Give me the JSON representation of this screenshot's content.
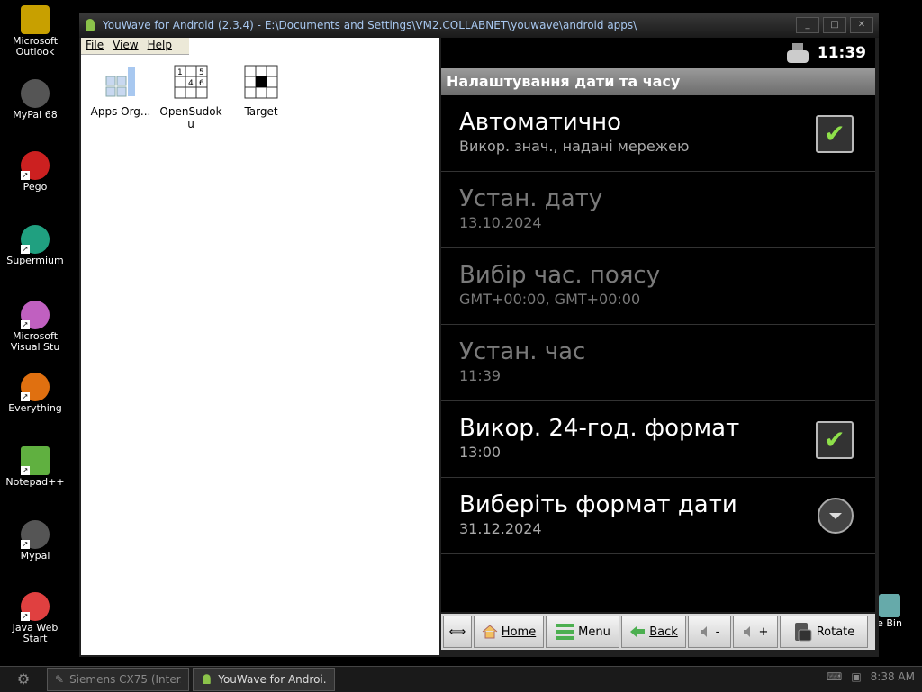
{
  "desktop": {
    "icons": [
      {
        "label": "Microsoft\nOutlook",
        "color": "#c8a000"
      },
      {
        "label": "MyPal 68",
        "color": "#555555"
      },
      {
        "label": "Pego",
        "color": "#cc2020"
      },
      {
        "label": "Supermium",
        "color": "#20a080"
      },
      {
        "label": "Microsoft\nVisual Stu",
        "color": "#c060c0"
      },
      {
        "label": "Everything",
        "color": "#e07010"
      },
      {
        "label": "Notepad++",
        "color": "#60b040"
      },
      {
        "label": "Mypal",
        "color": "#555555"
      },
      {
        "label": "Java Web\nStart",
        "color": "#e04040"
      }
    ],
    "recycle_label": "e Bin"
  },
  "window": {
    "title": "YouWave for Android (2.3.4) - E:\\Documents and Settings\\VM2.COLLABNET\\youwave\\android apps\\",
    "menu": [
      "File",
      "View",
      "Help"
    ],
    "apps": [
      {
        "label": "Apps Org..."
      },
      {
        "label": "OpenSudoku"
      },
      {
        "label": "Target"
      }
    ]
  },
  "android": {
    "clock": "11:39",
    "header": "Налаштування дати та часу",
    "items": [
      {
        "title": "Автоматично",
        "subtitle": "Викор. знач., надані мережею",
        "control": "check",
        "enabled": true
      },
      {
        "title": "Устан. дату",
        "subtitle": "13.10.2024",
        "control": "none",
        "enabled": false
      },
      {
        "title": "Вибір час. поясу",
        "subtitle": "GMT+00:00, GMT+00:00",
        "control": "none",
        "enabled": false
      },
      {
        "title": "Устан. час",
        "subtitle": "11:39",
        "control": "none",
        "enabled": false
      },
      {
        "title": "Викор. 24-год. формат",
        "subtitle": "13:00",
        "control": "check",
        "enabled": true
      },
      {
        "title": "Виберіть формат дати",
        "subtitle": "31.12.2024",
        "control": "dropdown",
        "enabled": true
      }
    ],
    "check_mark": "✔"
  },
  "toolbar": {
    "swap": "⟺",
    "home": "Home",
    "menu": "Menu",
    "back": "Back",
    "vol_down": "-",
    "vol_up": "+",
    "rotate": "Rotate"
  },
  "taskbar": {
    "tasks": [
      "Siemens CX75 (Inter...",
      "YouWave for Androi..."
    ],
    "clock": "8:38 AM"
  }
}
